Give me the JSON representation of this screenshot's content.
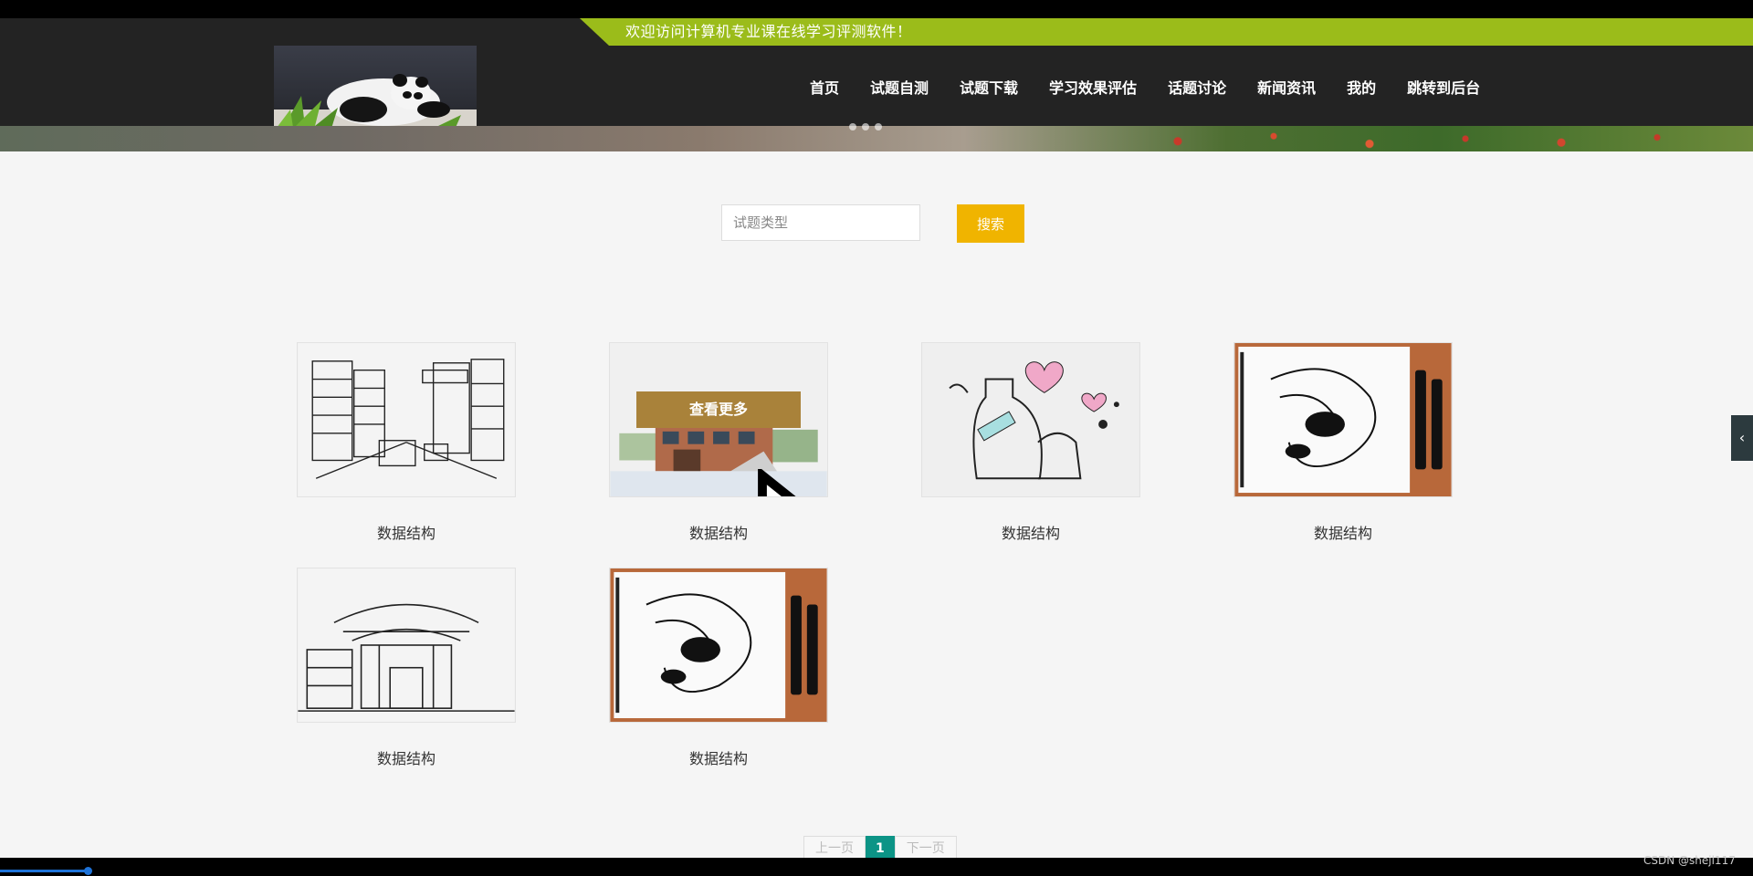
{
  "header": {
    "welcome": "欢迎访问计算机专业课在线学习评测软件！",
    "nav": [
      "首页",
      "试题自测",
      "试题下载",
      "学习效果评估",
      "话题讨论",
      "新闻资讯",
      "我的",
      "跳转到后台"
    ]
  },
  "search": {
    "placeholder": "试题类型",
    "button_label": "搜索"
  },
  "cards": [
    {
      "caption": "数据结构",
      "image": "street-sketch"
    },
    {
      "caption": "数据结构",
      "image": "building-watercolor",
      "hover_label": "查看更多"
    },
    {
      "caption": "数据结构",
      "image": "bottles-hearts"
    },
    {
      "caption": "数据结构",
      "image": "dragon-drawing"
    },
    {
      "caption": "数据结构",
      "image": "chinese-gate-sketch"
    },
    {
      "caption": "数据结构",
      "image": "dragon-drawing"
    }
  ],
  "pagination": {
    "prev": "上一页",
    "current": "1",
    "next": "下一页"
  },
  "side_tab_icon": "chevron-left-icon",
  "watermark": "CSDN @shejl117",
  "colors": {
    "welcome_bar": "#9bbc1a",
    "search_button": "#f0b400",
    "more_button": "#a9823a",
    "page_active": "#0c9486"
  }
}
